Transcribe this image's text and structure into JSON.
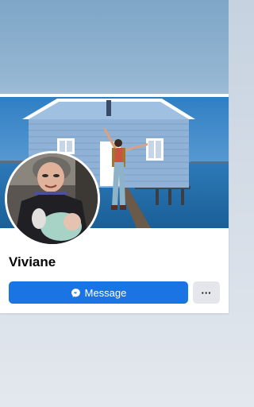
{
  "profile": {
    "name": "Viviane",
    "message_label": "Message",
    "more_label": "···"
  },
  "icons": {
    "message": "messenger-icon",
    "more": "more-options-icon"
  },
  "colors": {
    "primary_button": "#1b74e4",
    "secondary_button": "#e4e6eb",
    "name_text": "#050505",
    "page_background_top": "#7ea6c7"
  }
}
